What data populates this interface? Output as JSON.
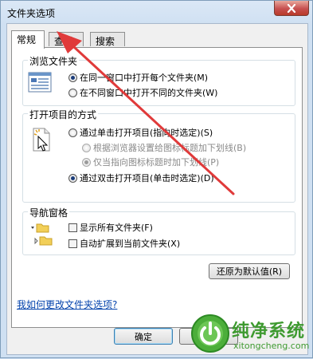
{
  "window": {
    "title": "文件夹选项"
  },
  "tabs": [
    {
      "label": "常规"
    },
    {
      "label": "查看"
    },
    {
      "label": "搜索"
    }
  ],
  "browse_group": {
    "title": "浏览文件夹",
    "options": [
      {
        "label": "在同一窗口中打开每个文件夹(M)",
        "selected": true
      },
      {
        "label": "在不同窗口中打开不同的文件夹(W)",
        "selected": false
      }
    ]
  },
  "open_group": {
    "title": "打开项目的方式",
    "single_click": "通过单击打开项目(指向时选定)(S)",
    "underline_browser": "根据浏览器设置给图标标题加下划线(B)",
    "underline_hover": "仅当指向图标标题时加下划线(P)",
    "double_click": "通过双击打开项目(单击时选定)(D)"
  },
  "nav_group": {
    "title": "导航窗格",
    "show_all": "显示所有文件夹(F)",
    "auto_expand": "自动扩展到当前文件夹(X)"
  },
  "restore_button": "还原为默认值(R)",
  "help_link": "我如何更改文件夹选项?",
  "footer": {
    "ok": "确定"
  },
  "watermark": {
    "brand": "纯净系统",
    "url": "xitongcheng.com"
  },
  "annotation": {
    "arrow_color": "#e03a3a"
  }
}
